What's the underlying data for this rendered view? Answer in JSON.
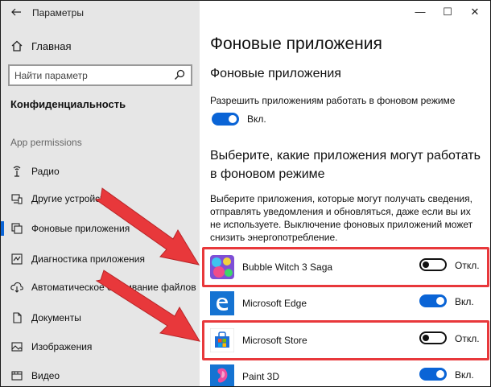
{
  "window": {
    "title": "Параметры",
    "controls": [
      "—",
      "☐",
      "✕"
    ]
  },
  "sidebar": {
    "home_label": "Главная",
    "search_placeholder": "Найти параметр",
    "section_title": "Конфиденциальность",
    "group_title": "App permissions",
    "items": [
      {
        "label": "Радио",
        "icon": "radio-icon"
      },
      {
        "label": "Другие устройства",
        "icon": "devices-icon"
      },
      {
        "label": "Фоновые приложения",
        "icon": "background-apps-icon",
        "active": true
      },
      {
        "label": "Диагностика приложения",
        "icon": "diagnostics-icon"
      },
      {
        "label": "Автоматическое скачивание файлов",
        "icon": "cloud-download-icon"
      },
      {
        "label": "Документы",
        "icon": "document-icon"
      },
      {
        "label": "Изображения",
        "icon": "image-icon"
      },
      {
        "label": "Видео",
        "icon": "video-icon"
      }
    ]
  },
  "main": {
    "page_title": "Фоновые приложения",
    "sub_title": "Фоновые приложения",
    "allow_text": "Разрешить приложениям работать в фоновом режиме",
    "allow_toggle": {
      "state": "on",
      "label": "Вкл."
    },
    "choose_title": "Выберите, какие приложения могут работать в фоновом режиме",
    "description": "Выберите приложения, которые могут получать сведения, отправлять уведомления и обновляться, даже если вы их не используете. Выключение фоновых приложений может снизить энергопотребление.",
    "apps": [
      {
        "name": "Bubble Witch 3 Saga",
        "toggle": "off",
        "toggle_label": "Откл.",
        "highlighted": true
      },
      {
        "name": "Microsoft Edge",
        "toggle": "on",
        "toggle_label": "Вкл.",
        "highlighted": false
      },
      {
        "name": "Microsoft Store",
        "toggle": "off",
        "toggle_label": "Откл.",
        "highlighted": true
      },
      {
        "name": "Paint 3D",
        "toggle": "on",
        "toggle_label": "Вкл.",
        "highlighted": false
      }
    ]
  },
  "colors": {
    "accent": "#0a64d6",
    "annotation": "#e8383b",
    "sidebar_bg": "#e6e6e6"
  }
}
